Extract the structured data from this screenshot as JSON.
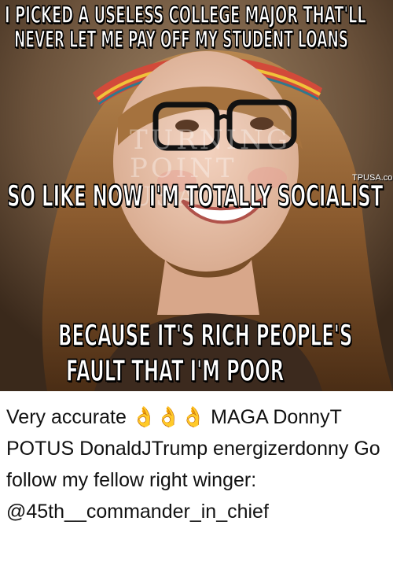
{
  "meme": {
    "top_line_1": "I PICKED A USELESS COLLEGE MAJOR THAT'LL",
    "top_line_2": "NEVER LET ME PAY OFF MY STUDENT LOANS",
    "middle_line": "SO LIKE NOW I'M TOTALLY SOCIALIST",
    "bottom_line_1": "BECAUSE IT'S RICH PEOPLE'S",
    "bottom_line_2": "FAULT THAT I'M POOR",
    "watermark": "TPUSA.com",
    "faint_overlay": "TURNING POINT USA"
  },
  "post": {
    "caption": "Very accurate 👌👌👌 MAGA DonnyT POTUS DonaldJTrump energizerdonny Go follow my fellow right winger: @45th__commander_in_chief"
  }
}
